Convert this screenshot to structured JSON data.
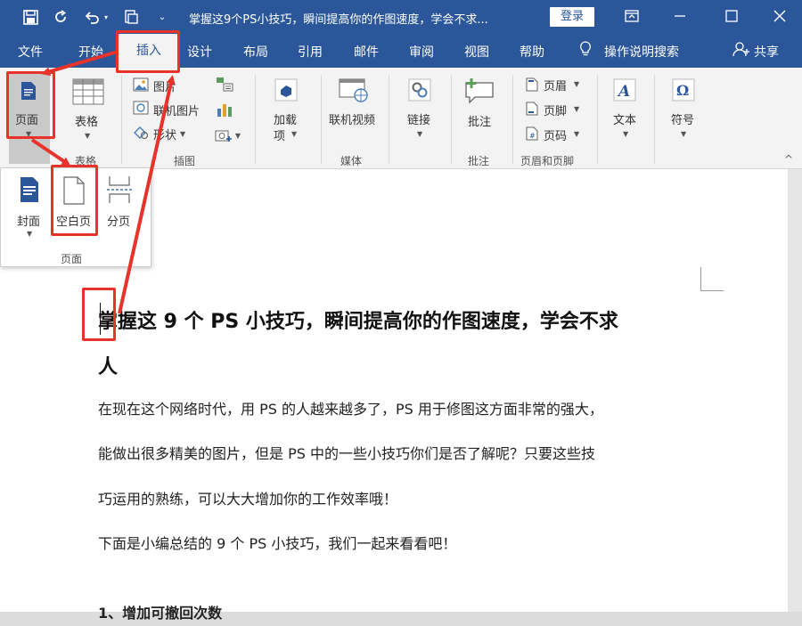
{
  "titlebar": {
    "title": "掌握这9个PS小技巧，瞬间提高你的作图速度，学会不求...",
    "login": "登录",
    "save_icon": "save-icon",
    "colors": {
      "bar": "#2b579a"
    }
  },
  "tabs": [
    "文件",
    "开始",
    "插入",
    "设计",
    "布局",
    "引用",
    "邮件",
    "审阅",
    "视图",
    "帮助"
  ],
  "tell_me": "操作说明搜索",
  "share": "共享",
  "ribbon": {
    "page_btn": "页面",
    "table_btn": "表格",
    "table_group": "表格",
    "illus": {
      "picture": "图片",
      "online_picture": "联机图片",
      "shapes": "形状",
      "group": "插图"
    },
    "addins": {
      "label1": "加载",
      "label2": "项"
    },
    "media": {
      "online_video": "联机视频",
      "group": "媒体"
    },
    "link": "链接",
    "comment": {
      "label": "批注",
      "group": "批注"
    },
    "header_footer": {
      "header": "页眉",
      "footer": "页脚",
      "page_number": "页码",
      "group": "页眉和页脚"
    },
    "text": "文本",
    "symbol": "符号"
  },
  "page_panel": {
    "cover": "封面",
    "blank": "空白页",
    "break": "分页",
    "group": "页面"
  },
  "document": {
    "title_line1": "掌握这 9 个 PS 小技巧，瞬间提高你的作图速度，学会不求",
    "title_line2": "人",
    "para1_line1": "在现在这个网络时代，用 PS 的人越来越多了，PS 用于修图这方面非常的强大，",
    "para1_line2": "能做出很多精美的图片，但是 PS 中的一些小技巧你们是否了解呢？只要这些技",
    "para1_line3": "巧运用的熟练，可以大大增加你的工作效率哦！",
    "para2": "下面是小编总结的 9 个 PS 小技巧，我们一起来看看吧！",
    "heading1": "1、增加可撤回次数"
  }
}
